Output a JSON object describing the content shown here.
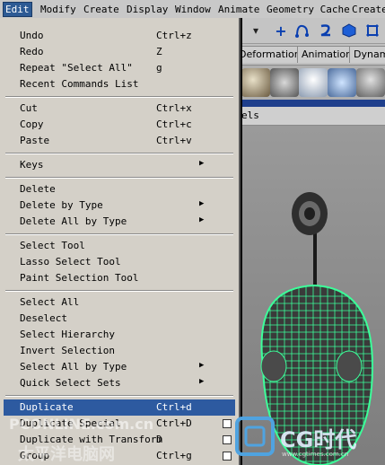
{
  "menubar": {
    "items": [
      "Edit",
      "Modify",
      "Create",
      "Display",
      "Window",
      "Animate",
      "Geometry Cache",
      "Create"
    ]
  },
  "shelf_tabs": [
    "Deformation",
    "Animation",
    "Dynami"
  ],
  "panel": {
    "label": "els"
  },
  "edit_menu": {
    "groups": [
      [
        {
          "label": "Undo",
          "shortcut": "Ctrl+z"
        },
        {
          "label": "Redo",
          "shortcut": "Z"
        },
        {
          "label": "Repeat \"Select All\"",
          "shortcut": "g"
        },
        {
          "label": "Recent Commands List",
          "shortcut": ""
        }
      ],
      [
        {
          "label": "Cut",
          "shortcut": "Ctrl+x"
        },
        {
          "label": "Copy",
          "shortcut": "Ctrl+c"
        },
        {
          "label": "Paste",
          "shortcut": "Ctrl+v"
        }
      ],
      [
        {
          "label": "Keys",
          "shortcut": "",
          "submenu": true
        }
      ],
      [
        {
          "label": "Delete",
          "shortcut": ""
        },
        {
          "label": "Delete by Type",
          "shortcut": "",
          "submenu": true
        },
        {
          "label": "Delete All by Type",
          "shortcut": "",
          "submenu": true
        }
      ],
      [
        {
          "label": "Select Tool",
          "shortcut": ""
        },
        {
          "label": "Lasso Select Tool",
          "shortcut": ""
        },
        {
          "label": "Paint Selection Tool",
          "shortcut": ""
        }
      ],
      [
        {
          "label": "Select All",
          "shortcut": ""
        },
        {
          "label": "Deselect",
          "shortcut": ""
        },
        {
          "label": "Select Hierarchy",
          "shortcut": ""
        },
        {
          "label": "Invert Selection",
          "shortcut": ""
        },
        {
          "label": "Select All by Type",
          "shortcut": "",
          "submenu": true
        },
        {
          "label": "Quick Select Sets",
          "shortcut": "",
          "submenu": true
        }
      ],
      [
        {
          "label": "Duplicate",
          "shortcut": "Ctrl+d",
          "highlighted": true
        },
        {
          "label": "Duplicate Special",
          "shortcut": "Ctrl+D",
          "option": true
        },
        {
          "label": "Duplicate with Transform",
          "shortcut": "D",
          "option": true
        },
        {
          "label": "Group",
          "shortcut": "Ctrl+g",
          "option": true
        }
      ]
    ]
  },
  "watermarks": {
    "left_top": "PCONLINE.com.cn",
    "left_bottom": "太平洋电脑网",
    "logo": "CG时代",
    "logo_url": "www.cgtimes.com.cn"
  },
  "colors": {
    "menu_bg": "#d4d0c8",
    "highlight": "#2d5aa0",
    "mesh": "#3cff9a"
  },
  "icons": {
    "toolbar": [
      "arrow-down-icon",
      "plus-icon",
      "curve-icon",
      "s-curve-icon",
      "cube-icon",
      "frame-icon"
    ]
  }
}
